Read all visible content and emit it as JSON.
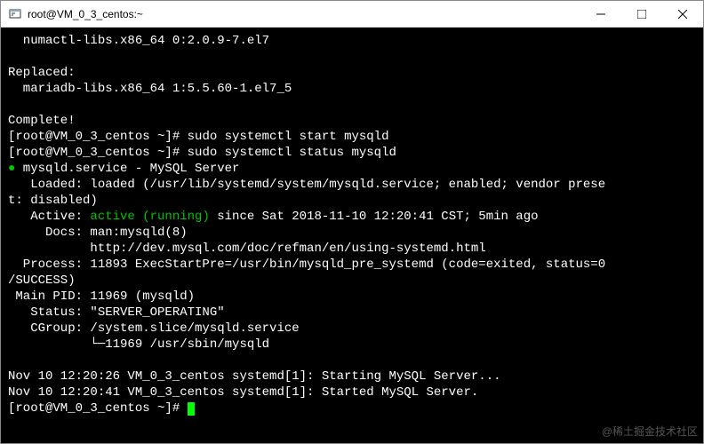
{
  "titlebar": {
    "title": "root@VM_0_3_centos:~"
  },
  "terminal": {
    "line1": "  numactl-libs.x86_64 0:2.0.9-7.el7",
    "blank": "",
    "line2": "Replaced:",
    "line3": "  mariadb-libs.x86_64 1:5.5.60-1.el7_5",
    "line4": "Complete!",
    "prompt1a": "[root@VM_0_3_centos ~]# ",
    "cmd1": "sudo systemctl start mysqld",
    "prompt2a": "[root@VM_0_3_centos ~]# ",
    "cmd2": "sudo systemctl status mysqld",
    "svc_bullet": "●",
    "svc_name": " mysqld.service - MySQL Server",
    "loaded": "   Loaded: loaded (/usr/lib/systemd/system/mysqld.service; enabled; vendor prese",
    "loaded2": "t: disabled)",
    "active_lbl": "   Active: ",
    "active_val": "active (running)",
    "active_rest": " since Sat 2018-11-10 12:20:41 CST; 5min ago",
    "docs1": "     Docs: man:mysqld(8)",
    "docs2": "           http://dev.mysql.com/doc/refman/en/using-systemd.html",
    "process": "  Process: 11893 ExecStartPre=/usr/bin/mysqld_pre_systemd (code=exited, status=0",
    "process2": "/SUCCESS)",
    "mainpid": " Main PID: 11969 (mysqld)",
    "status": "   Status: \"SERVER_OPERATING\"",
    "cgroup1": "   CGroup: /system.slice/mysqld.service",
    "cgroup2": "           └─11969 /usr/sbin/mysqld",
    "log1": "Nov 10 12:20:26 VM_0_3_centos systemd[1]: Starting MySQL Server...",
    "log2": "Nov 10 12:20:41 VM_0_3_centos systemd[1]: Started MySQL Server.",
    "prompt3": "[root@VM_0_3_centos ~]# "
  },
  "watermark": "@稀土掘金技术社区"
}
